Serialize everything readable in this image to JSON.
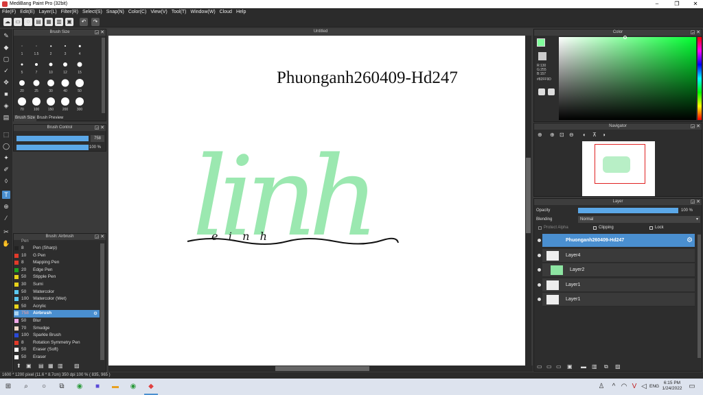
{
  "window": {
    "title": "MediBang Paint Pro (32bit)",
    "min": "–",
    "max": "❐",
    "close": "✕"
  },
  "menu": [
    "File(F)",
    "Edit(E)",
    "Layer(L)",
    "Filter(R)",
    "Select(S)",
    "Snap(N)",
    "Color(C)",
    "View(V)",
    "Tool(T)",
    "Window(W)",
    "Cloud",
    "Help"
  ],
  "brush_size_panel": {
    "title": "Brush Size",
    "sizes": [
      "1",
      "1.5",
      "2",
      "3",
      "4",
      "5",
      "7",
      "10",
      "12",
      "15",
      "20",
      "25",
      "30",
      "40",
      "50",
      "70",
      "100",
      "150",
      "200",
      "300"
    ],
    "tabs": [
      "Brush Size",
      "Brush Preview"
    ]
  },
  "brush_control": {
    "title": "Brush Control",
    "size_value": "758",
    "opacity_value": "100 %",
    "opacity_fill": 1.0
  },
  "brush_panel": {
    "title": "Brush: Airbrush",
    "top_partial": "Pen",
    "items": [
      {
        "size": "8",
        "name": "Pen (Sharp)",
        "color": "#222222"
      },
      {
        "size": "10",
        "name": "G Pen",
        "color": "#e23a2a"
      },
      {
        "size": "8",
        "name": "Mapping Pen",
        "color": "#e23a2a"
      },
      {
        "size": "20",
        "name": "Edge Pen",
        "color": "#1fa31f"
      },
      {
        "size": "50",
        "name": "Stipple Pen",
        "color": "#e8d21a"
      },
      {
        "size": "30",
        "name": "Sumi",
        "color": "#e8d21a"
      },
      {
        "size": "50",
        "name": "Watercolor",
        "color": "#5bc8f0"
      },
      {
        "size": "100",
        "name": "Watercolor (Wet)",
        "color": "#5bc8f0"
      },
      {
        "size": "50",
        "name": "Acrylic",
        "color": "#e8d21a"
      },
      {
        "size": "758",
        "name": "Airbrush",
        "color": "#aad4f0",
        "selected": true
      },
      {
        "size": "50",
        "name": "Blur",
        "color": "#f0a8e8"
      },
      {
        "size": "70",
        "name": "Smudge",
        "color": "#f0d8c8"
      },
      {
        "size": "100",
        "name": "Sparkle Brush",
        "color": "#2a4ad8"
      },
      {
        "size": "8",
        "name": "Rotation Symmetry Pen",
        "color": "#e23a2a"
      },
      {
        "size": "50",
        "name": "Eraser (Soft)",
        "color": "#ffffff"
      },
      {
        "size": "50",
        "name": "Eraser",
        "color": "#ffffff"
      }
    ]
  },
  "canvas": {
    "tab_title": "Untitled",
    "text": "Phuonganh260409-Hd247",
    "lettering": "linh",
    "script": "e   i   n   h"
  },
  "color_panel": {
    "title": "Color",
    "r": "R:130",
    "g": "G:255",
    "b": "B:157",
    "hex": "#82FF9D"
  },
  "navigator": {
    "title": "Navigator"
  },
  "layer_panel": {
    "title": "Layer",
    "opacity_label": "Opacity",
    "opacity_value": "100 %",
    "opacity_fill": 1.0,
    "blending_label": "Blending",
    "blending_value": "Normal",
    "protect_alpha": "Protect Alpha",
    "clipping": "Clipping",
    "lock": "Lock",
    "layers": [
      {
        "name": "Phuonganh260409-Hd247",
        "selected": true
      },
      {
        "name": "Layer4"
      },
      {
        "name": "Layer2"
      },
      {
        "name": "Layer1"
      },
      {
        "name": "Layer1"
      }
    ]
  },
  "status": {
    "text": "1600 * 1200 pixel   (11.6 * 8.7cm)   350 dpi   100 %   ( 835, 965 )"
  },
  "taskbar": {
    "time": "6:15 PM",
    "date": "1/24/2022",
    "lang": "ENG"
  },
  "colors": {
    "accent": "#4a8fd0",
    "primary_color": "#82FF9D",
    "lettering": "#9be8b0"
  }
}
